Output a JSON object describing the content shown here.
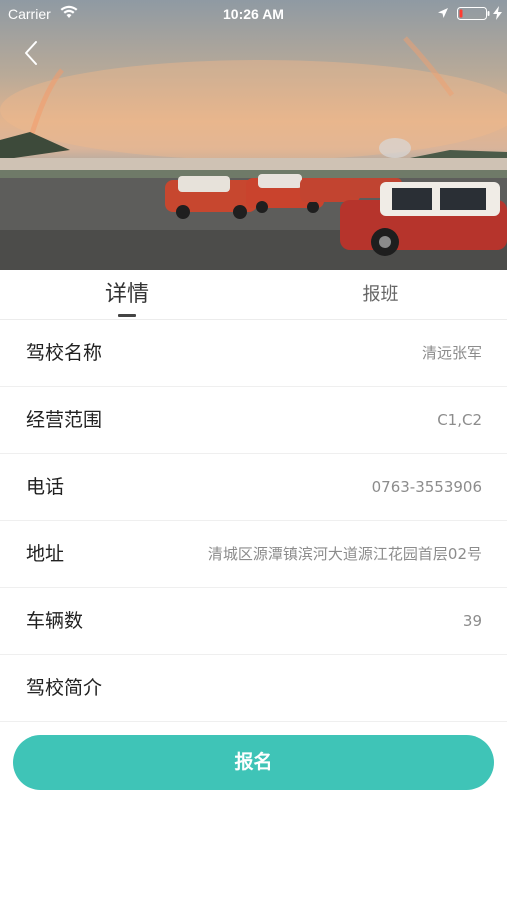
{
  "status_bar": {
    "carrier": "Carrier",
    "time": "10:26 AM"
  },
  "header": {
    "icons": [
      "wifi-icon",
      "location-icon",
      "battery-icon",
      "charge-icon",
      "back-arrow-icon"
    ],
    "battery_color": "#ff3b30"
  },
  "tabs": [
    {
      "label": "详情",
      "active": true
    },
    {
      "label": "报班",
      "active": false
    }
  ],
  "school_info": [
    {
      "label": "驾校名称",
      "value": "清远张军"
    },
    {
      "label": "经营范围",
      "value": "C1,C2"
    },
    {
      "label": "电话",
      "value": "0763-3553906"
    },
    {
      "label": "地址",
      "value": "清城区源潭镇滨河大道源江花园首层02号"
    },
    {
      "label": "车辆数",
      "value": "39"
    },
    {
      "label": "驾校简介",
      "value": ""
    }
  ],
  "actions": {
    "enroll_label": "报名"
  },
  "colors": {
    "accent": "#3fc4b7"
  }
}
